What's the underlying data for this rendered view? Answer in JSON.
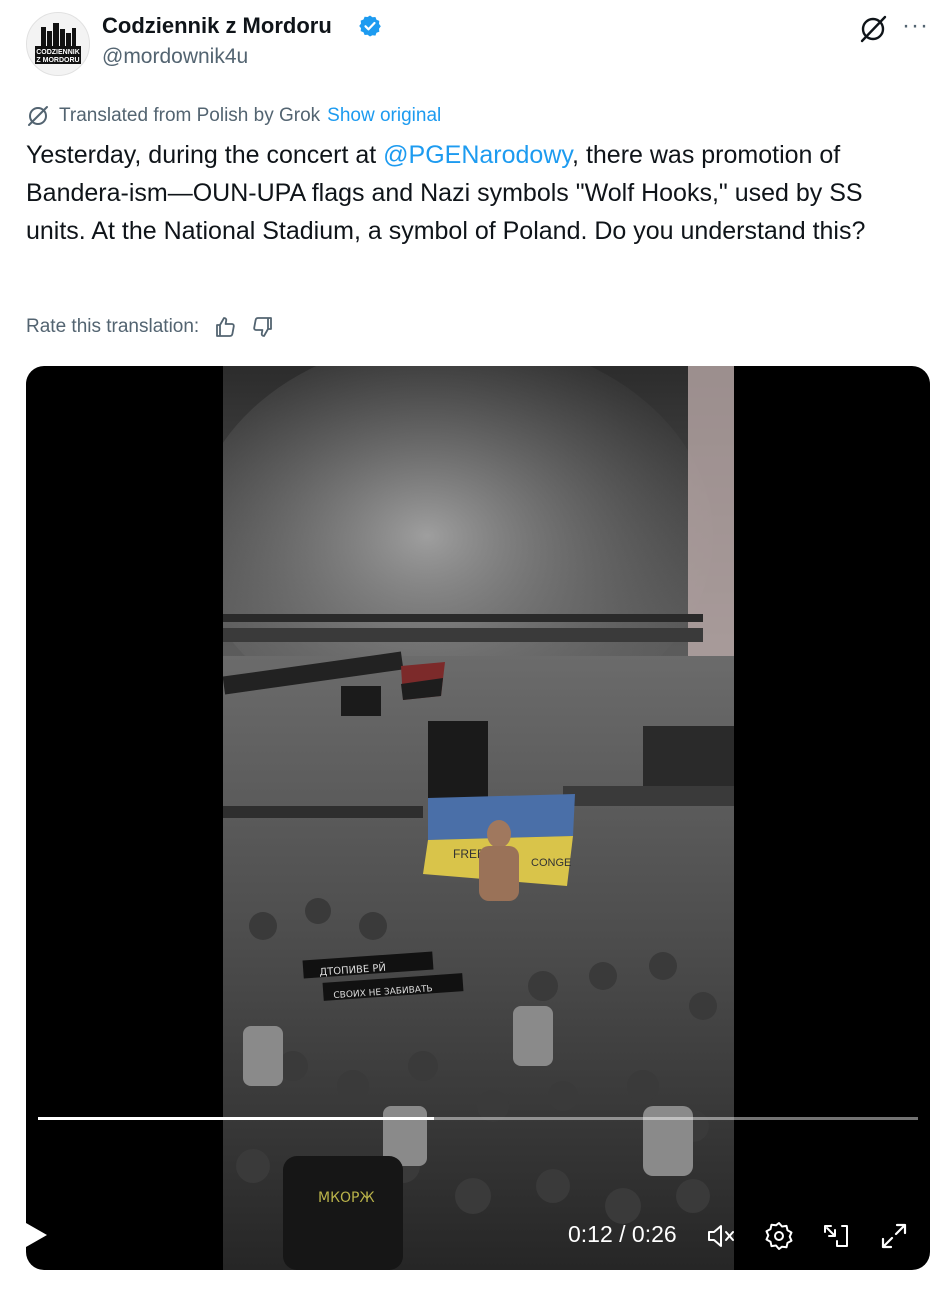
{
  "author": {
    "name": "Codziennik z Mordoru",
    "handle": "@mordownik4u",
    "avatar_text_line1": "CODZIENNIK",
    "avatar_text_line2": "Z MORDORU",
    "verified": true
  },
  "translation": {
    "note": "Translated from Polish by Grok",
    "show_original": "Show original",
    "rate_label": "Rate this translation:"
  },
  "tweet": {
    "text_before_mention": "Yesterday, during the concert at ",
    "mention": "@PGENarodowy",
    "text_after_mention": ", there was promotion of Bandera-ism—OUN-UPA flags and Nazi symbols \"Wolf Hooks,\" used by SS units. At the National Stadium, a symbol of Poland. Do you understand this?"
  },
  "video": {
    "time_display": "0:12 / 0:26",
    "progress": 0.45,
    "flag_text_left": "FREE",
    "flag_text_right": "CONGE",
    "banner_text_1": "ДТОПИВЕ РЙ",
    "banner_text_2": "СВОИХ НЕ ЗАБИВАТЬ",
    "shirt_text": "МКОРЖ"
  },
  "colors": {
    "link": "#1d9bf0",
    "secondary_text": "#536471",
    "primary_text": "#0f1419",
    "verified_badge": "#1d9bf0"
  },
  "icons": {
    "verified": "verified-badge-icon",
    "grok": "grok-icon",
    "more": "more-icon",
    "translate": "grok-translate-icon",
    "thumbs_up": "thumbs-up-icon",
    "thumbs_down": "thumbs-down-icon",
    "play": "play-icon",
    "mute": "volume-muted-icon",
    "settings": "settings-gear-icon",
    "pip": "picture-in-picture-icon",
    "fullscreen": "fullscreen-icon"
  }
}
